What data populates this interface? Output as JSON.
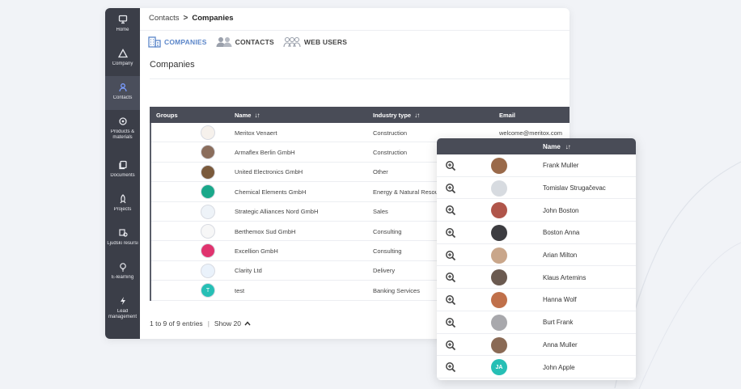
{
  "sidebar": {
    "items": [
      {
        "label": "Home",
        "icon": "monitor-icon"
      },
      {
        "label": "Company",
        "icon": "triangle-icon"
      },
      {
        "label": "Contacts",
        "icon": "person-icon"
      },
      {
        "label": "Products & materials",
        "icon": "gear-icon"
      },
      {
        "label": "Documents",
        "icon": "documents-icon"
      },
      {
        "label": "Projects",
        "icon": "rocket-icon"
      },
      {
        "label": "Ljudski resursi",
        "icon": "hr-icon"
      },
      {
        "label": "E-learning",
        "icon": "lightbulb-icon"
      },
      {
        "label": "Lead management",
        "icon": "bolt-icon"
      }
    ]
  },
  "breadcrumb": {
    "parent": "Contacts",
    "separator": ">",
    "current": "Companies"
  },
  "tabs": [
    {
      "label": "COMPANIES",
      "icon": "building-icon"
    },
    {
      "label": "CONTACTS",
      "icon": "people-icon"
    },
    {
      "label": "WEB USERS",
      "icon": "web-users-icon"
    }
  ],
  "section_title": "Companies",
  "table": {
    "columns": {
      "groups": "Groups",
      "name": "Name",
      "industry": "Industry type",
      "email": "Email"
    },
    "sort_glyph": "↓↑",
    "rows": [
      {
        "name": "Meritox Venaert",
        "industry": "Construction",
        "email": "welcome@meritox.com",
        "logo_color": "#f6f1ec",
        "logo_text": ""
      },
      {
        "name": "Armaflex Berlin GmbH",
        "industry": "Construction",
        "email": "",
        "logo_color": "#8a6d5c",
        "logo_text": ""
      },
      {
        "name": "United Electronics GmbH",
        "industry": "Other",
        "email": "",
        "logo_color": "#7a5a3c",
        "logo_text": ""
      },
      {
        "name": "Chemical Elements GmbH",
        "industry": "Energy & Natural Resources",
        "email": "",
        "logo_color": "#1aa88a",
        "logo_text": ""
      },
      {
        "name": "Strategic Alliances Nord GmbH",
        "industry": "Sales",
        "email": "",
        "logo_color": "#eef3f8",
        "logo_text": ""
      },
      {
        "name": "Berthemox Sud GmbH",
        "industry": "Consulting",
        "email": "",
        "logo_color": "#f7f7f7",
        "logo_text": ""
      },
      {
        "name": "Excellion GmbH",
        "industry": "Consulting",
        "email": "",
        "logo_color": "#e0336e",
        "logo_text": ""
      },
      {
        "name": "Clarity Ltd",
        "industry": "Delivery",
        "email": "",
        "logo_color": "#eaf2fb",
        "logo_text": ""
      },
      {
        "name": "test",
        "industry": "Banking Services",
        "email": "",
        "logo_color": "#26bfb5",
        "logo_text": "T"
      }
    ]
  },
  "pager": {
    "entries": "1 to 9 of 9 entries",
    "separator": "|",
    "show": "Show 20"
  },
  "popup": {
    "column": "Name",
    "sort_glyph": "↓↑",
    "rows": [
      {
        "name": "Frank Muller",
        "avatar_color": "#9a6a4a",
        "initials": ""
      },
      {
        "name": "Tomislav Strugačevac",
        "avatar_color": "#d7dbe0",
        "initials": ""
      },
      {
        "name": "John Boston",
        "avatar_color": "#b0554a",
        "initials": ""
      },
      {
        "name": "Boston Anna",
        "avatar_color": "#3c3c40",
        "initials": ""
      },
      {
        "name": "Arian Milton",
        "avatar_color": "#c9a68a",
        "initials": ""
      },
      {
        "name": "Klaus Artemins",
        "avatar_color": "#6b5a50",
        "initials": ""
      },
      {
        "name": "Hanna Wolf",
        "avatar_color": "#c0704a",
        "initials": ""
      },
      {
        "name": "Burt Frank",
        "avatar_color": "#a8a8ac",
        "initials": ""
      },
      {
        "name": "Anna Muller",
        "avatar_color": "#8a6a55",
        "initials": ""
      },
      {
        "name": "John Apple",
        "avatar_color": "#26bfb5",
        "initials": "JA"
      }
    ]
  },
  "colors": {
    "accent": "#5b86c9",
    "sidebar": "#3b3e48",
    "table_header": "#494c57"
  }
}
